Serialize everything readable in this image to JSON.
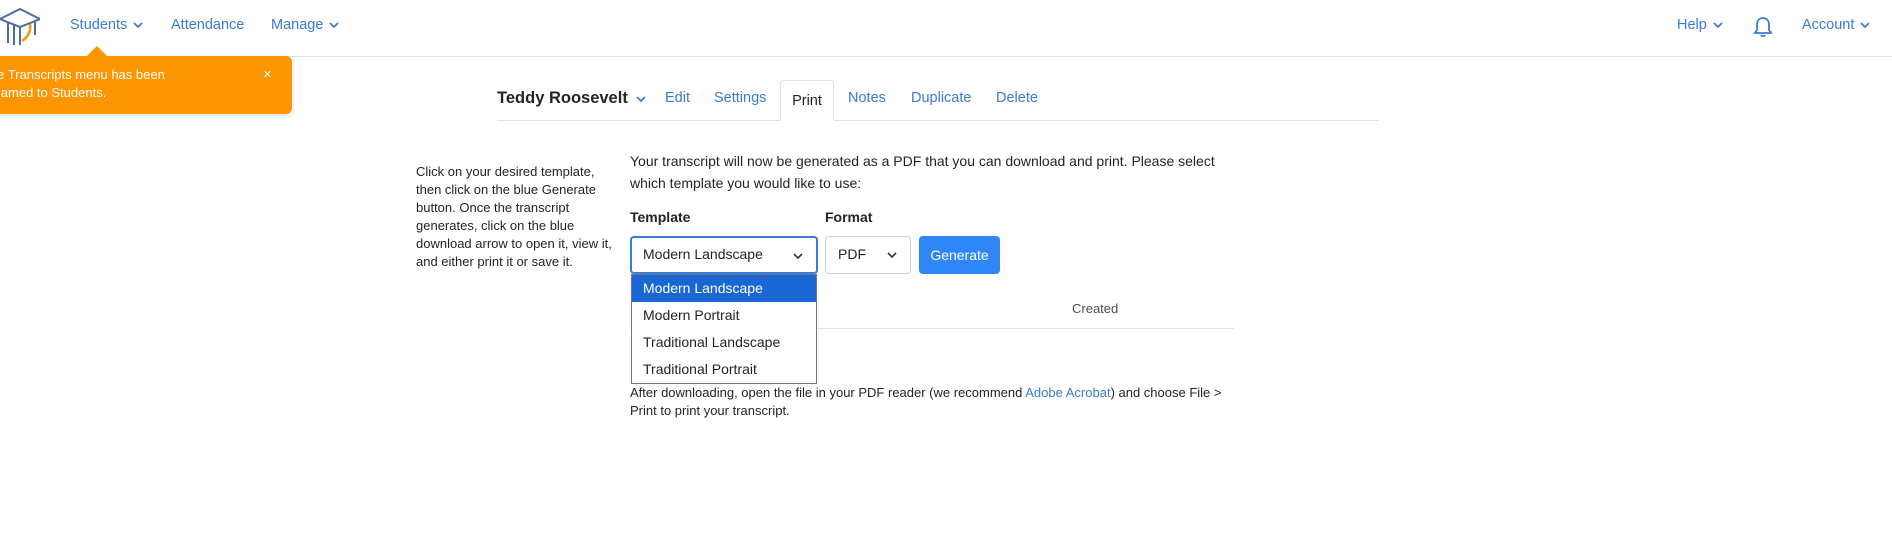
{
  "nav": {
    "students": "Students",
    "attendance": "Attendance",
    "manage": "Manage",
    "help": "Help",
    "account": "Account"
  },
  "toast": {
    "message": "The Transcripts menu has been renamed to Students.",
    "close": "×",
    "color": "#fd9500"
  },
  "student": {
    "name": "Teddy Roosevelt"
  },
  "tabs": {
    "edit": "Edit",
    "settings": "Settings",
    "print": "Print",
    "notes": "Notes",
    "duplicate": "Duplicate",
    "delete": "Delete"
  },
  "help_text": "Click on your desired template, then click on the blue Generate button. Once the transcript generates, click on the blue download arrow to open it, view it, and either print it or save it.",
  "intro": "Your transcript will now be generated as a PDF that you can download and print. Please select which template you would like to use:",
  "form": {
    "template_label": "Template",
    "format_label": "Format",
    "template_value": "Modern Landscape",
    "format_value": "PDF",
    "generate_label": "Generate",
    "template_options": [
      "Modern Landscape",
      "Modern Portrait",
      "Traditional Landscape",
      "Traditional Portrait"
    ]
  },
  "table": {
    "created_header": "Created"
  },
  "footer": {
    "before_link": "After downloading, open the file in your PDF reader (we recommend ",
    "link": "Adobe Acrobat",
    "after_link": ") and choose File > Print to print your transcript."
  },
  "colors": {
    "accent": "#3a7bd5",
    "button": "#2f86f6",
    "selected_option": "#1a66d2"
  }
}
